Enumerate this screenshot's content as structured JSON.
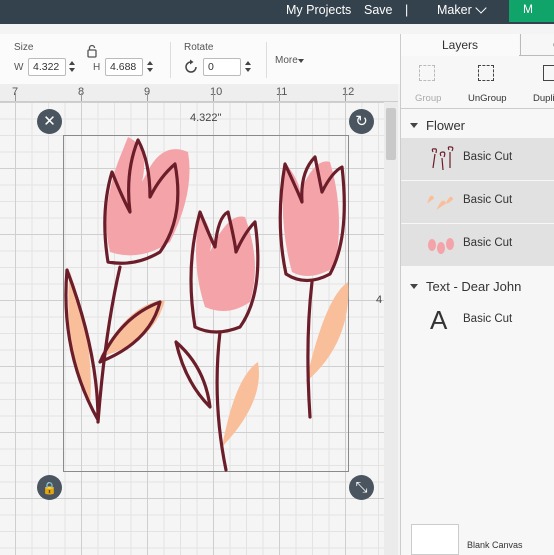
{
  "topbar": {
    "my_projects": "My Projects",
    "save": "Save",
    "separator": "|",
    "machine": "Maker",
    "make": "M"
  },
  "toolbar": {
    "size_label": "Size",
    "width_label": "W",
    "width_value": "4.322",
    "height_label": "H",
    "height_value": "4.688",
    "rotate_label": "Rotate",
    "rotate_value": "0",
    "more_label": "More"
  },
  "ruler": {
    "marks": [
      "7",
      "8",
      "9",
      "10",
      "11",
      "12"
    ]
  },
  "canvas": {
    "width_readout": "4.322\"",
    "height_readout": "4",
    "colors": {
      "outline": "#6b1e2a",
      "pink": "#f4a4a8",
      "peach": "#f9bf9b"
    }
  },
  "panel": {
    "tab_layers": "Layers",
    "tab_other": "C",
    "actions": {
      "group": "Group",
      "ungroup": "UnGroup",
      "duplicate": "Dupli"
    },
    "groups": [
      {
        "name": "Flower",
        "layers": [
          "Basic Cut",
          "Basic Cut",
          "Basic Cut"
        ]
      },
      {
        "name": "Text - Dear John",
        "layers": [
          "Basic Cut"
        ]
      }
    ],
    "text_glyph": "A",
    "blank_canvas": "Blank Canvas"
  }
}
